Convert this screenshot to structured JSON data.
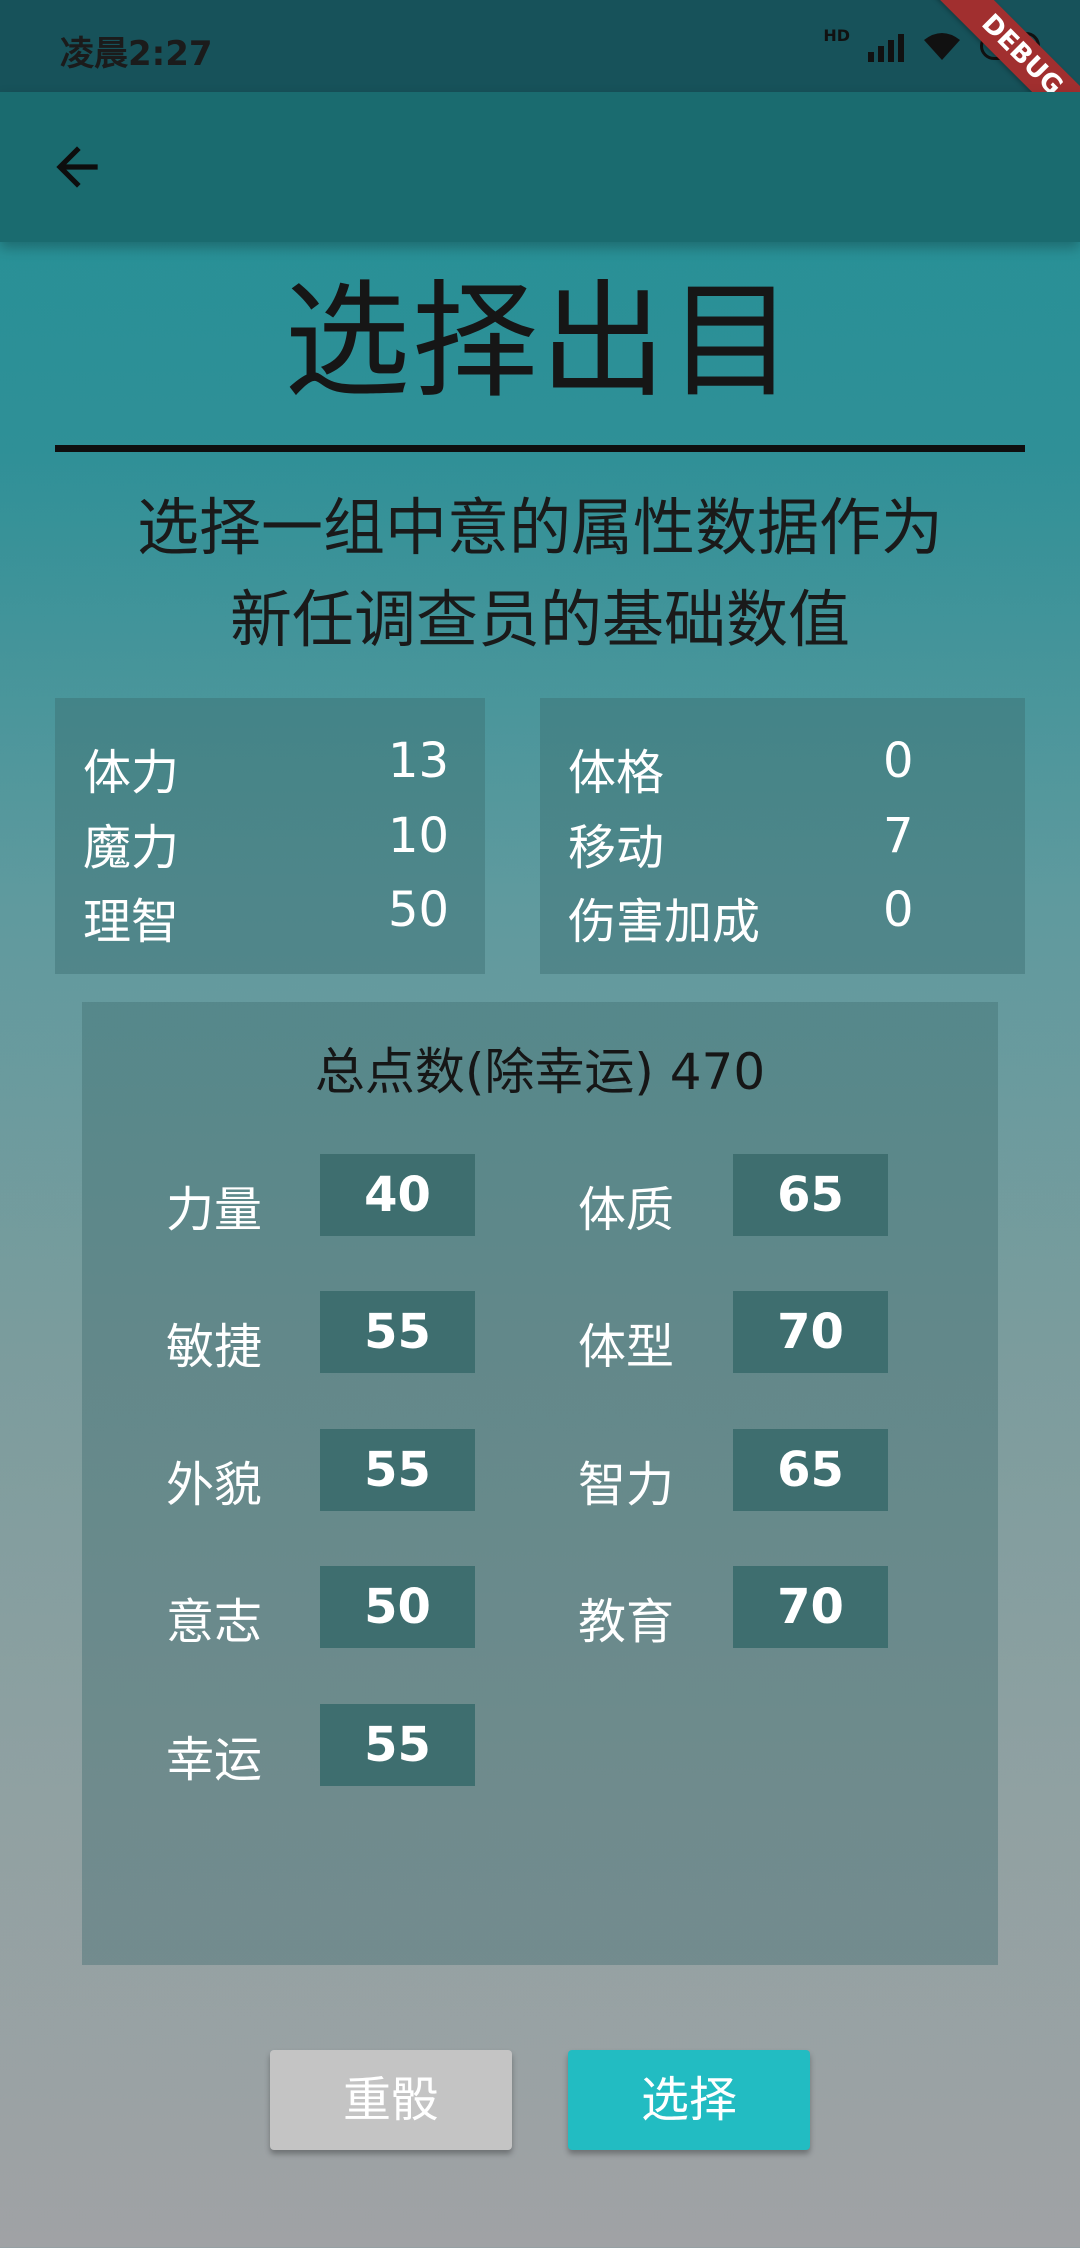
{
  "status": {
    "time": "凌晨2:27",
    "network": "HD",
    "debug_banner": "DEBUG"
  },
  "nav": {
    "back_icon": "arrow-left-icon"
  },
  "page": {
    "title": "选择出目",
    "subtitle_line1": "选择一组中意的属性数据作为",
    "subtitle_line2": "新任调查员的基础数值"
  },
  "derived_left": [
    {
      "label": "体力",
      "value": "13"
    },
    {
      "label": "魔力",
      "value": "10"
    },
    {
      "label": "理智",
      "value": "50"
    }
  ],
  "derived_right": [
    {
      "label": "体格",
      "value": "0"
    },
    {
      "label": "移动",
      "value": "7"
    },
    {
      "label": "伤害加成",
      "value": "0"
    }
  ],
  "attributes": {
    "total_label": "总点数(除幸运) 470",
    "left": [
      {
        "label": "力量",
        "value": "40"
      },
      {
        "label": "敏捷",
        "value": "55"
      },
      {
        "label": "外貌",
        "value": "55"
      },
      {
        "label": "意志",
        "value": "50"
      },
      {
        "label": "幸运",
        "value": "55"
      }
    ],
    "right": [
      {
        "label": "体质",
        "value": "65"
      },
      {
        "label": "体型",
        "value": "70"
      },
      {
        "label": "智力",
        "value": "65"
      },
      {
        "label": "教育",
        "value": "70"
      }
    ]
  },
  "actions": {
    "reroll_label": "重骰",
    "select_label": "选择"
  },
  "colors": {
    "select_button": "#22bcc2",
    "reroll_button": "#c4c4c4",
    "appbar": "#1a6b6f"
  }
}
